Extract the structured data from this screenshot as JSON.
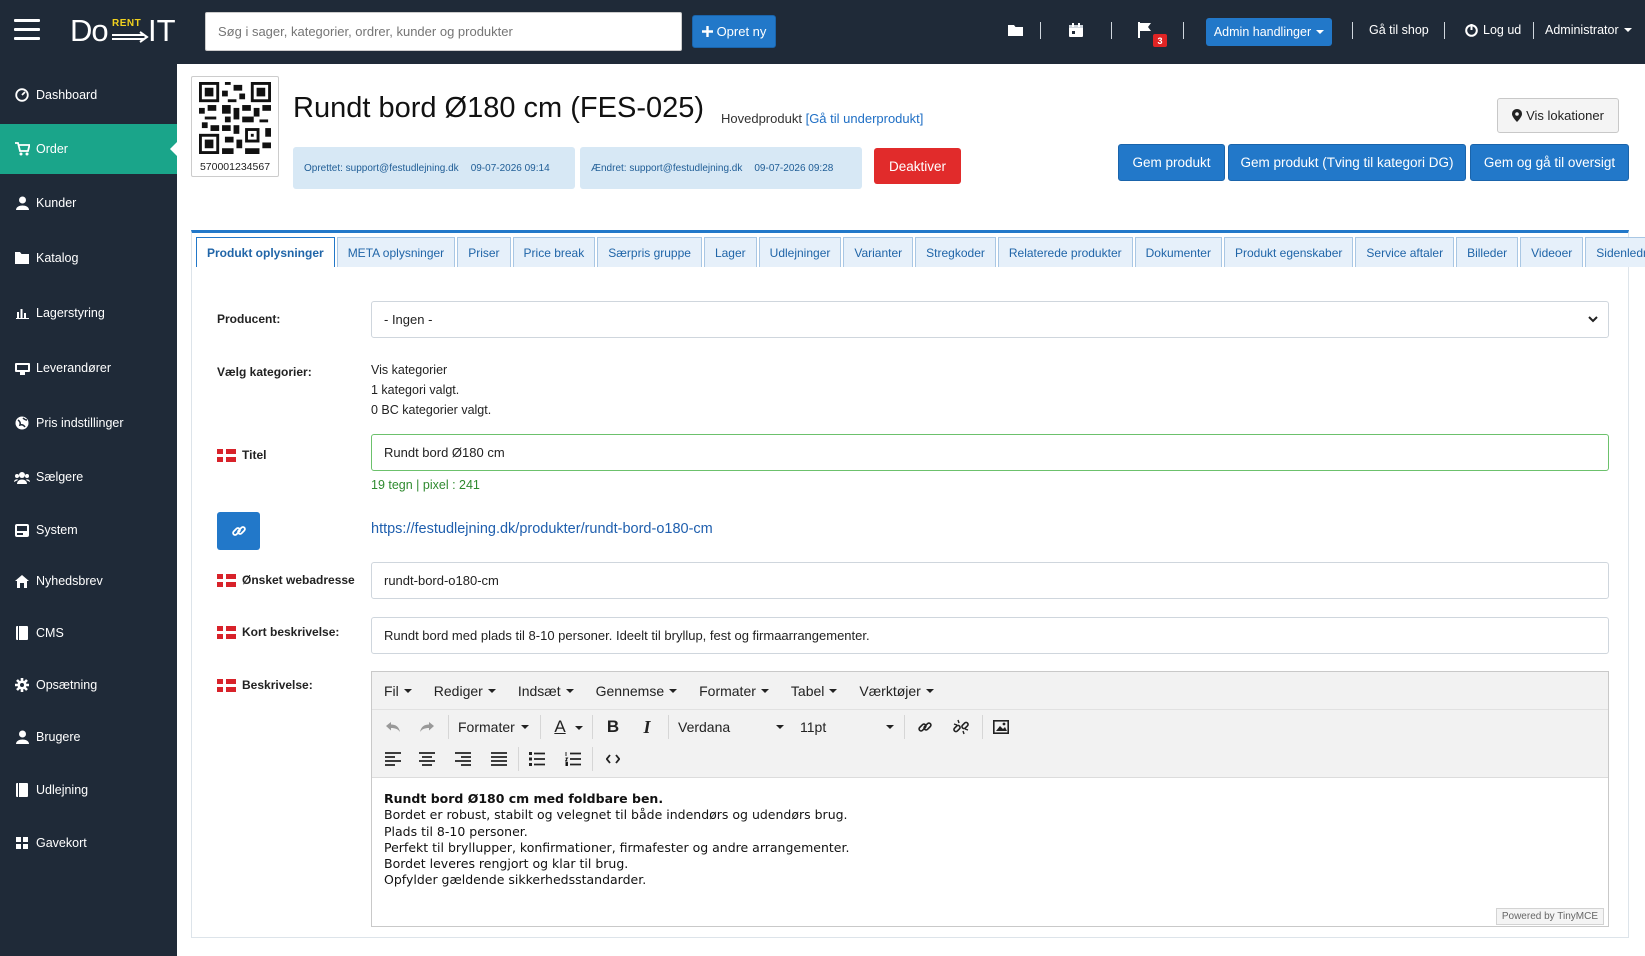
{
  "app": {
    "logo_do": "Do",
    "logo_rent": "RENT",
    "logo_it": "IT"
  },
  "topbar": {
    "search_placeholder": "Søg i sager, kategorier, ordrer, kunder og produkter",
    "new_button": "Opret ny",
    "flag_count": "3",
    "admin_actions": "Admin handlinger",
    "go_to_shop": "Gå til shop",
    "logout": "Log ud",
    "user": "Administrator",
    "icons": [
      "folder-icon",
      "calendar-icon",
      "flag-icon",
      "logout-icon"
    ]
  },
  "sidebar": {
    "items": [
      {
        "label": "Dashboard",
        "icon": "dashboard-icon"
      },
      {
        "label": "Order",
        "icon": "cart-icon",
        "active": true
      },
      {
        "label": "Kunder",
        "icon": "user-icon"
      },
      {
        "label": "Katalog",
        "icon": "folder-icon"
      },
      {
        "label": "Lagerstyring",
        "icon": "bar-chart-icon"
      },
      {
        "label": "Leverandører",
        "icon": "truck-icon"
      },
      {
        "label": "Pris indstillinger",
        "icon": "globe-icon"
      },
      {
        "label": "Sælgere",
        "icon": "users-icon"
      },
      {
        "label": "System",
        "icon": "hdd-icon"
      },
      {
        "label": "Nyhedsbrev",
        "icon": "home-icon"
      },
      {
        "label": "CMS",
        "icon": "book-icon"
      },
      {
        "label": "Opsætning",
        "icon": "gear-icon"
      },
      {
        "label": "Brugere",
        "icon": "user-icon"
      },
      {
        "label": "Udlejning",
        "icon": "book-icon"
      },
      {
        "label": "Gavekort",
        "icon": "sitemap-icon"
      }
    ]
  },
  "product": {
    "qr_number": "570001234567",
    "title": "Rundt bord Ø180 cm (FES-025)",
    "type": "Hovedprodukt",
    "sub_link": "[Gå til underprodukt]",
    "created_label": "Oprettet: support@festudlejning.dk",
    "created_date": "09-07-2026 09:14",
    "changed_label": "Ændret: support@festudlejning.dk",
    "changed_date": "09-07-2026 09:28",
    "deactivate": "Deaktiver",
    "show_locations": "Vis lokationer",
    "save": "Gem produkt",
    "save_force": "Gem produkt (Tving til kategori DG)",
    "save_overview": "Gem og gå til oversigt"
  },
  "tabs": [
    "Produkt oplysninger",
    "META oplysninger",
    "Priser",
    "Price break",
    "Særpris gruppe",
    "Lager",
    "Udlejninger",
    "Varianter",
    "Stregkoder",
    "Relaterede produkter",
    "Dokumenter",
    "Produkt egenskaber",
    "Service aftaler",
    "Billeder",
    "Videoer",
    "Sidenledning"
  ],
  "form": {
    "producer_label": "Producent:",
    "producer_value": "- Ingen -",
    "categories_label": "Vælg kategorier:",
    "categories_show": "Vis kategorier",
    "categories_count": "1 kategori valgt.",
    "bc_categories": "0 BC kategorier valgt.",
    "title_label": "Titel",
    "title_value": "Rundt bord Ø180 cm",
    "title_stats": "19 tegn | pixel : 241",
    "url": "https://festudlejning.dk/produkter/rundt-bord-o180-cm",
    "webaddress_label": "Ønsket webadresse",
    "webaddress_value": "rundt-bord-o180-cm",
    "short_desc_label": "Kort beskrivelse:",
    "short_desc_value": "Rundt bord med plads til 8-10 personer. Ideelt til bryllup, fest og firmaarrangementer.",
    "desc_label": "Beskrivelse:"
  },
  "editor": {
    "menu": [
      "Fil",
      "Rediger",
      "Indsæt",
      "Gennemse",
      "Formater",
      "Tabel",
      "Værktøjer"
    ],
    "format": "Formater",
    "font": "Verdana",
    "size": "11pt",
    "content_bold": "Rundt bord Ø180 cm med foldbare ben.",
    "content_lines": [
      "Bordet er robust, stabilt og velegnet til både indendørs og udendørs brug.",
      "Plads til 8-10 personer.",
      "Perfekt til bryllupper, konfirmationer, firmafester og andre arrangementer.",
      "Bordet leveres rengjort og klar til brug.",
      "Opfylder gældende sikkerhedsstandarder."
    ],
    "powered": "Powered by TinyMCE"
  },
  "colors": {
    "topbar": "#1f2a38",
    "active": "#1aa58a",
    "primary": "#2278c9",
    "danger": "#e12b2b"
  }
}
